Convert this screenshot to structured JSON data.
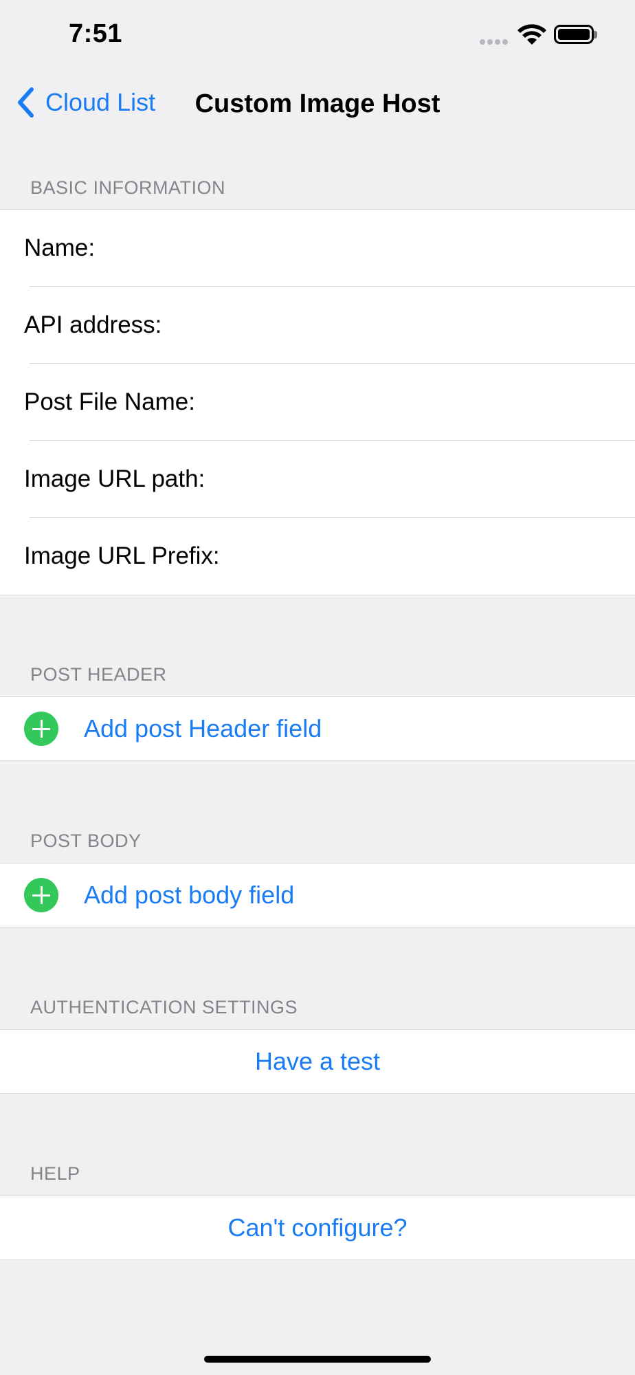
{
  "status_bar": {
    "time": "7:51",
    "icons": [
      "signal-icon",
      "wifi-icon",
      "battery-icon"
    ]
  },
  "nav": {
    "back_label": "Cloud List",
    "title": "Custom Image Host",
    "back_icon": "chevron-left-icon"
  },
  "colors": {
    "accent": "#1a7cf4",
    "add_green": "#34c759",
    "background": "#f0f0f2",
    "section_header": "#838388"
  },
  "basic_information": {
    "header": "BASIC INFORMATION",
    "fields": [
      {
        "label": "Name:",
        "value": ""
      },
      {
        "label": "API address:",
        "value": ""
      },
      {
        "label": "Post File Name:",
        "value": ""
      },
      {
        "label": "Image URL path:",
        "value": ""
      },
      {
        "label": "Image URL Prefix:",
        "value": ""
      }
    ]
  },
  "post_header": {
    "header": "POST HEADER",
    "add_label": "Add post Header field",
    "icon": "plus-circle-icon"
  },
  "post_body": {
    "header": "POST BODY",
    "add_label": "Add post body field",
    "icon": "plus-circle-icon"
  },
  "authentication": {
    "header": "AUTHENTICATION SETTINGS",
    "button_label": "Have a test"
  },
  "help": {
    "header": "HELP",
    "button_label": "Can't configure?"
  }
}
